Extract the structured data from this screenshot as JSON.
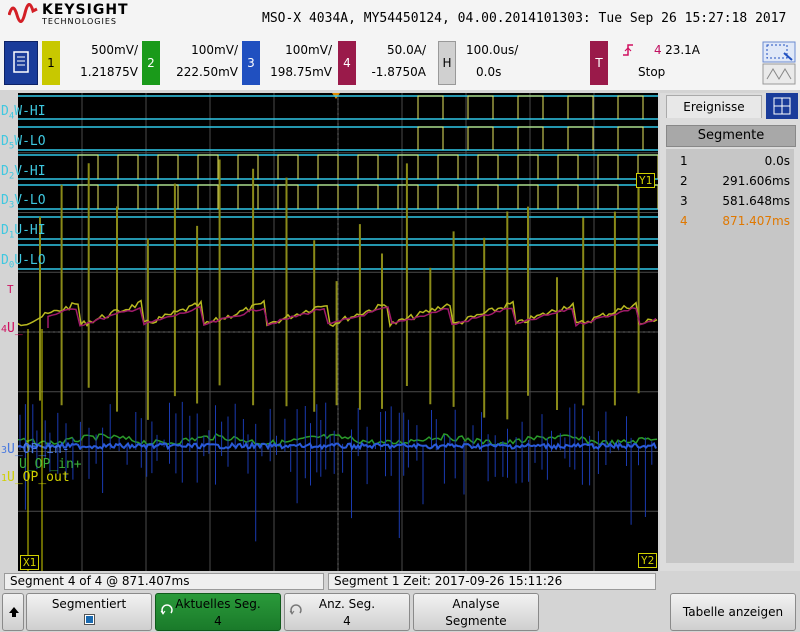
{
  "header": {
    "brand": "KEYSIGHT",
    "brand_sub": "TECHNOLOGIES",
    "model_info": "MSO-X 4034A, MY54450124, 04.00.2014101303: Tue Sep 26 15:27:18 2017"
  },
  "channels": [
    {
      "id": "1",
      "scale": "500mV/",
      "offset": "1.21875V",
      "color": "#c8c800"
    },
    {
      "id": "2",
      "scale": "100mV/",
      "offset": "222.50mV",
      "color": "#1a9a1a"
    },
    {
      "id": "3",
      "scale": "100mV/",
      "offset": "198.75mV",
      "color": "#2050c0"
    },
    {
      "id": "4",
      "scale": "50.0A/",
      "offset": "-1.8750A",
      "color": "#9a1a4a"
    }
  ],
  "horizontal": {
    "key": "H",
    "scale": "100.0us/",
    "delay": "0.0s"
  },
  "trigger": {
    "key": "T",
    "source": "4",
    "level": "23.1A",
    "status": "Stop"
  },
  "digital_labels": [
    {
      "prefix": "D",
      "sub": "4",
      "name": "W-HI"
    },
    {
      "prefix": "D",
      "sub": "5",
      "name": "W-LO"
    },
    {
      "prefix": "D",
      "sub": "2",
      "name": "V-HI"
    },
    {
      "prefix": "D",
      "sub": "3",
      "name": "V-LO"
    },
    {
      "prefix": "D",
      "sub": "1",
      "name": "U-HI"
    },
    {
      "prefix": "D",
      "sub": "0",
      "name": "U-LO"
    }
  ],
  "analog_labels": {
    "ch4": "U_",
    "ch3": "U_OP_in-",
    "ch2": "U_OP_in+",
    "ch1": "U_OP_out"
  },
  "markers": {
    "y1": "Y1",
    "y2": "Y2",
    "x1": "X1",
    "trig": "T"
  },
  "panel": {
    "tab": "Ereignisse",
    "header": "Segmente",
    "segments": [
      {
        "n": "1",
        "t": "0.0s"
      },
      {
        "n": "2",
        "t": "291.606ms"
      },
      {
        "n": "3",
        "t": "581.648ms"
      },
      {
        "n": "4",
        "t": "871.407ms"
      }
    ],
    "highlight_color": "#e07800"
  },
  "status": {
    "left": "Segment 4 of 4 @ 871.407ms",
    "right": "Segment 1 Zeit: 2017-09-26 15:11:26"
  },
  "softkeys": {
    "seg_label": "Segmentiert",
    "current_label": "Aktuelles Seg.",
    "current_value": "4",
    "count_label": "Anz. Seg.",
    "count_value": "4",
    "analyse_l1": "Analyse",
    "analyse_l2": "Segmente",
    "table_label": "Tabelle anzeigen"
  }
}
